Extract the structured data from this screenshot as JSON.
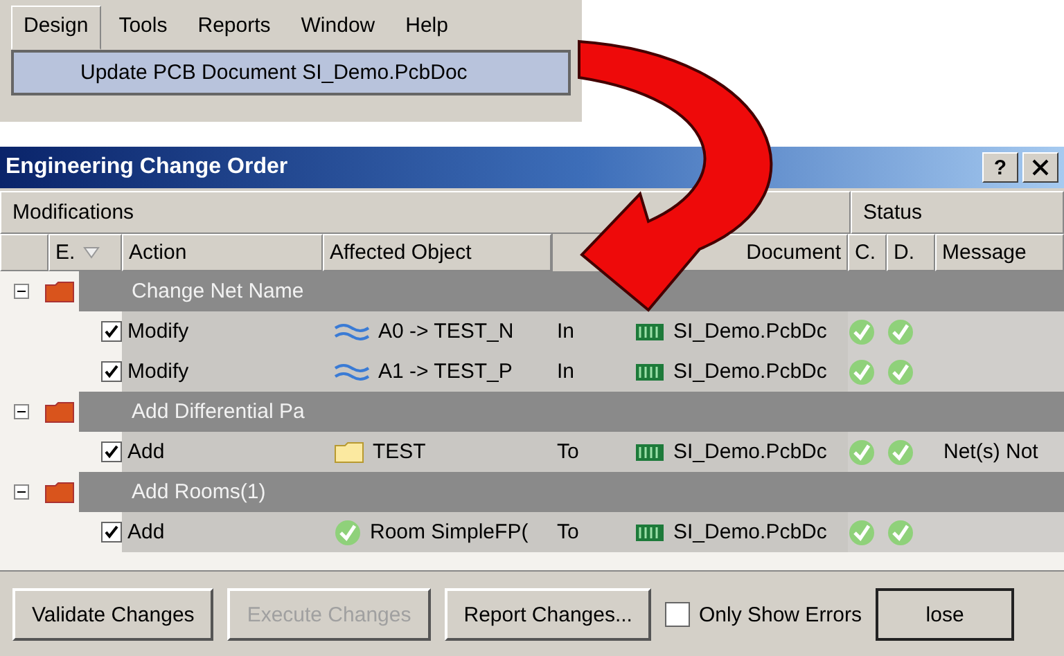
{
  "menu_bar": {
    "items": [
      {
        "label": "Design",
        "selected": true
      },
      {
        "label": "Tools",
        "selected": false
      },
      {
        "label": "Reports",
        "selected": false
      },
      {
        "label": "Window",
        "selected": false
      },
      {
        "label": "Help",
        "selected": false
      }
    ]
  },
  "menu_dropdown": {
    "items": [
      {
        "label": "Update PCB Document SI_Demo.PcbDoc",
        "selected": true
      }
    ]
  },
  "dialog": {
    "title": "Engineering Change Order",
    "help_button": "?",
    "column_groups": [
      "Modifications",
      "Status"
    ],
    "columns": [
      "E.",
      "Action",
      "Affected Object",
      "Document",
      "C.",
      "D.",
      "Message"
    ],
    "groups": [
      {
        "label": "Change Net Name",
        "expanded": true,
        "children": [
          {
            "enabled": true,
            "action": "Modify",
            "kind": "net",
            "object": "A0 -> TEST_N",
            "direction": "In",
            "document": "SI_Demo.PcbDc",
            "check_ok": true,
            "done_ok": true
          },
          {
            "enabled": true,
            "action": "Modify",
            "kind": "net",
            "object": "A1 -> TEST_P",
            "direction": "In",
            "document": "SI_Demo.PcbDc",
            "check_ok": true,
            "done_ok": true
          }
        ]
      },
      {
        "label": "Add Differential Pa",
        "expanded": true,
        "children": [
          {
            "enabled": true,
            "action": "Add",
            "kind": "class",
            "object": "TEST",
            "direction": "To",
            "document": "SI_Demo.PcbDc",
            "check_ok": true,
            "done_ok": true,
            "message": "Net(s) Not"
          }
        ]
      },
      {
        "label": "Add Rooms(1)",
        "expanded": true,
        "children": [
          {
            "enabled": true,
            "action": "Add",
            "kind": "room",
            "object": "Room SimpleFP(",
            "direction": "To",
            "document": "SI_Demo.PcbDc",
            "check_ok": true,
            "done_ok": true
          }
        ]
      }
    ],
    "buttons": [
      {
        "label": "Validate Changes",
        "disabled": false
      },
      {
        "label": "Execute Changes",
        "disabled": true
      },
      {
        "label": "Report Changes...",
        "disabled": false
      }
    ],
    "only_show_errors": {
      "label": "Only Show Errors",
      "checked": false
    },
    "close_button": {
      "label": "lose"
    }
  }
}
